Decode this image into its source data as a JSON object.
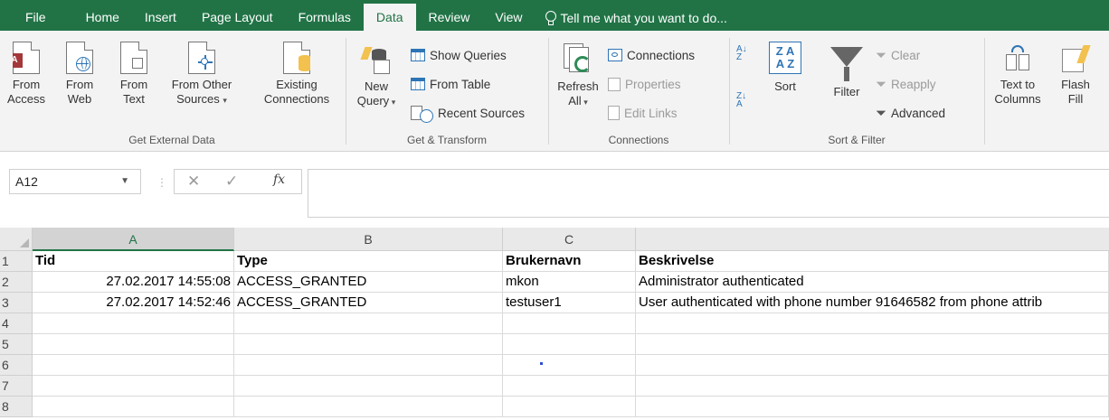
{
  "tabs": [
    "File",
    "Home",
    "Insert",
    "Page Layout",
    "Formulas",
    "Data",
    "Review",
    "View"
  ],
  "active_tab": "Data",
  "tell_me": "Tell me what you want to do...",
  "ribbon": {
    "get_external": {
      "label": "Get External Data",
      "from_access": [
        "From",
        "Access"
      ],
      "from_web": [
        "From",
        "Web"
      ],
      "from_text": [
        "From",
        "Text"
      ],
      "from_other": [
        "From Other",
        "Sources"
      ],
      "existing": [
        "Existing",
        "Connections"
      ]
    },
    "get_transform": {
      "label": "Get & Transform",
      "new_query": [
        "New",
        "Query"
      ],
      "show_queries": "Show Queries",
      "from_table": "From Table",
      "recent_sources": "Recent Sources"
    },
    "connections": {
      "label": "Connections",
      "refresh": [
        "Refresh",
        "All"
      ],
      "connections": "Connections",
      "properties": "Properties",
      "edit_links": "Edit Links"
    },
    "sort_filter": {
      "label": "Sort & Filter",
      "sort": "Sort",
      "filter": "Filter",
      "clear": "Clear",
      "reapply": "Reapply",
      "advanced": "Advanced"
    },
    "data_tools": {
      "text_to_columns": [
        "Text to",
        "Columns"
      ],
      "flash_fill": [
        "Flash",
        "Fill"
      ]
    }
  },
  "formula_bar": {
    "name_box": "A12",
    "fx": "fx",
    "value": ""
  },
  "sheet": {
    "columns": [
      "A",
      "B",
      "C",
      ""
    ],
    "selected_column": "A",
    "rows": [
      "1",
      "2",
      "3",
      "4",
      "5",
      "6",
      "7",
      "8"
    ],
    "cells": [
      [
        "Tid",
        "Type",
        "Brukernavn",
        "Beskrivelse"
      ],
      [
        "27.02.2017 14:55:08",
        "ACCESS_GRANTED",
        "mkon",
        "Administrator authenticated"
      ],
      [
        "27.02.2017 14:52:46",
        "ACCESS_GRANTED",
        "testuser1",
        "User authenticated with phone number 91646582 from phone attrib"
      ]
    ]
  },
  "colors": {
    "brand": "#217346",
    "ribbon_bg": "#f3f3f3",
    "access_red": "#a4373a",
    "accent_blue": "#2e75b6"
  }
}
